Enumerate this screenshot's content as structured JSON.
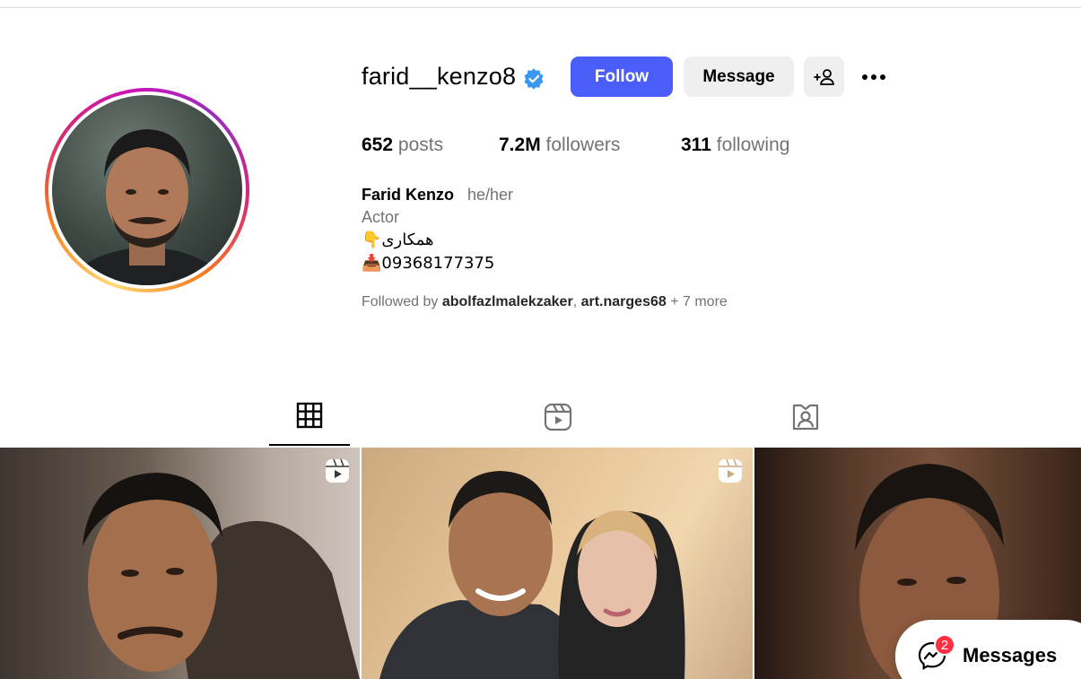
{
  "profile": {
    "username": "farid__kenzo8",
    "verified_icon": "verified-badge-icon",
    "accent_color": "#4a5df9",
    "buttons": {
      "follow": "Follow",
      "message": "Message",
      "add_user_icon": "add-user-icon",
      "more_icon": "more-options-icon"
    },
    "stats": {
      "posts_count": "652",
      "posts_label": "posts",
      "followers_count": "7.2M",
      "followers_label": "followers",
      "following_count": "311",
      "following_label": "following"
    },
    "full_name": "Farid Kenzo",
    "pronouns": "he/her",
    "category": "Actor",
    "bio": {
      "line1": "👇همکاری",
      "line2": "📥09368177375"
    },
    "followed_by": {
      "prefix": "Followed by",
      "user1": "abolfazlmalekzaker",
      "separator": ",",
      "user2": "art.narges68",
      "more": "+ 7 more"
    }
  },
  "tabs": [
    {
      "icon": "grid-icon",
      "active": true
    },
    {
      "icon": "reels-icon",
      "active": false
    },
    {
      "icon": "tagged-icon",
      "active": false
    }
  ],
  "posts": [
    {
      "type": "reel"
    },
    {
      "type": "reel"
    },
    {
      "type": "image"
    }
  ],
  "messages": {
    "label": "Messages",
    "unread_count": "2",
    "icon": "messenger-icon"
  }
}
